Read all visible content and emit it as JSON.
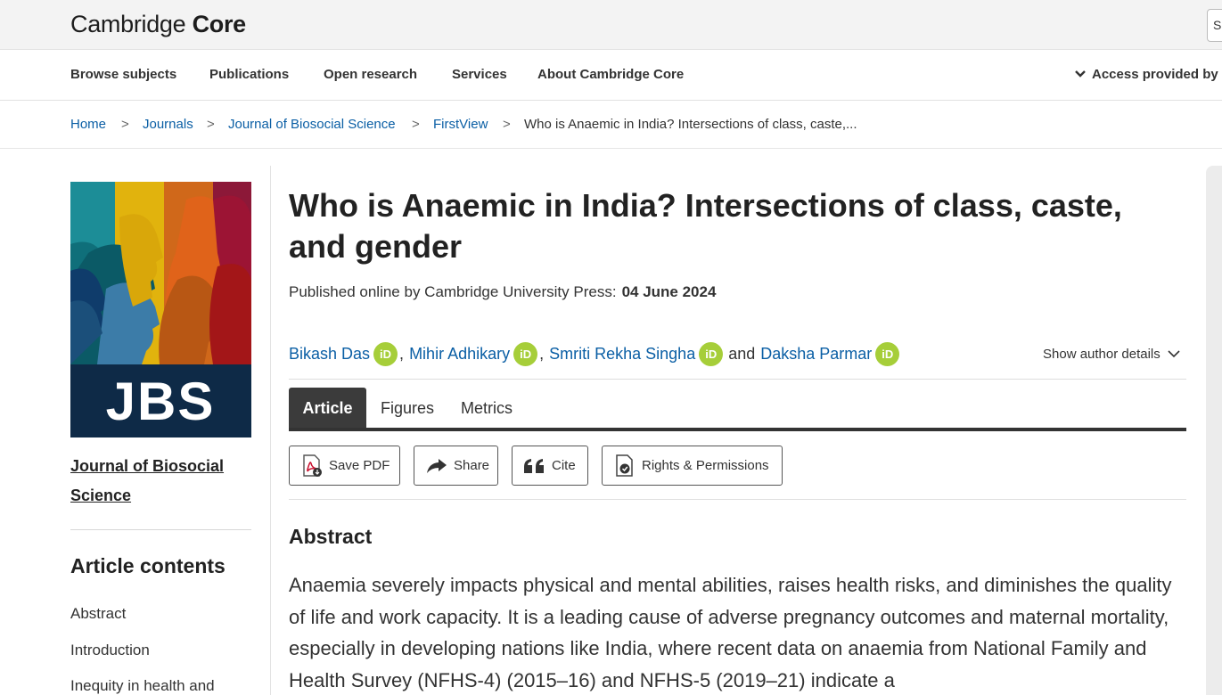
{
  "header": {
    "brand_part1": "Cambridge ",
    "brand_part2": "Core",
    "search_edge_label": "S"
  },
  "nav": {
    "items": [
      "Browse subjects",
      "Publications",
      "Open research",
      "Services",
      "About Cambridge Core"
    ],
    "access_label": "Access provided by"
  },
  "breadcrumb": {
    "items": [
      "Home",
      "Journals",
      "Journal of Biosocial Science",
      "FirstView"
    ],
    "current": "Who is Anaemic in India? Intersections of class, caste,..."
  },
  "sidebar": {
    "cover_text": "JBS",
    "journal_name": "Journal of Biosocial Science",
    "contents_heading": "Article contents",
    "toc": [
      "Abstract",
      "Introduction",
      "Inequity in health and"
    ]
  },
  "article": {
    "title": "Who is Anaemic in India? Intersections of class, caste, and gender",
    "published_prefix": "Published online by Cambridge University Press:",
    "published_date": "04 June 2024",
    "authors": [
      {
        "name": "Bikash Das",
        "sep": ","
      },
      {
        "name": "Mihir Adhikary",
        "sep": ","
      },
      {
        "name": "Smriti Rekha Singha",
        "sep": "and"
      },
      {
        "name": "Daksha Parmar",
        "sep": ""
      }
    ],
    "orcid_label": "iD",
    "show_details": "Show author details",
    "tabs": [
      "Article",
      "Figures",
      "Metrics"
    ],
    "actions": [
      "Save PDF",
      "Share",
      "Cite",
      "Rights & Permissions"
    ],
    "abstract_heading": "Abstract",
    "abstract_text": "Anaemia severely impacts physical and mental abilities, raises health risks, and diminishes the quality of life and work capacity. It is a leading cause of adverse pregnancy outcomes and maternal mortality, especially in developing nations like India, where recent data on anaemia from National Family and Health Survey (NFHS-4) (2015–16) and NFHS-5 (2019–21) indicate a"
  },
  "colors": {
    "link": "#0b5fa5",
    "orcid": "#a6ce39",
    "tab_active_bg": "#3b3b3b",
    "cover_bg": "#0e2a47"
  },
  "icons": [
    "chevron-down-icon",
    "pdf-icon",
    "share-arrow-icon",
    "quote-icon",
    "permissions-doc-icon",
    "orcid-icon"
  ]
}
